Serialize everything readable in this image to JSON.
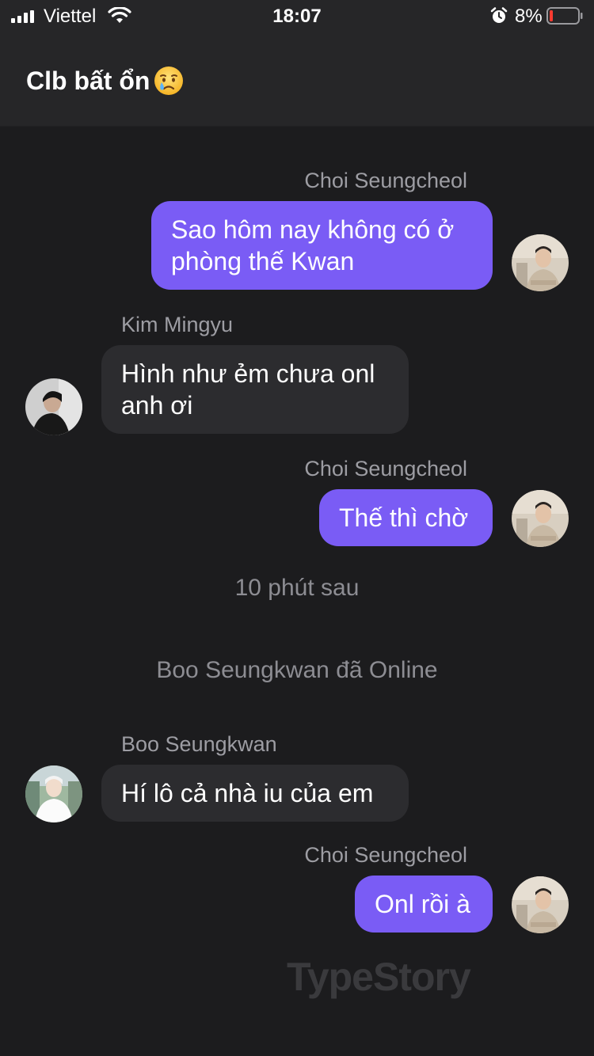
{
  "status_bar": {
    "carrier": "Viettel",
    "time": "18:07",
    "battery": "8%",
    "icons": [
      "signal-icon",
      "wifi-icon",
      "alarm-icon",
      "battery-icon"
    ]
  },
  "header": {
    "title": "Clb bất ổn",
    "emoji": "crying-face"
  },
  "messages": [
    {
      "sender": "Choi Seungcheol",
      "lines": [
        "Sao hôm nay không có ở",
        "phòng thế Kwan"
      ],
      "side": "right"
    },
    {
      "sender": "Kim Mingyu",
      "lines": [
        "Hình như ẻm chưa onl",
        "anh ơi"
      ],
      "side": "left"
    },
    {
      "sender": "Choi Seungcheol",
      "lines": [
        "Thế thì chờ"
      ],
      "side": "right"
    },
    {
      "sender": "Boo Seungkwan",
      "lines": [
        "Hí lô cả nhà iu của em"
      ],
      "side": "left"
    },
    {
      "sender": "Choi Seungcheol",
      "lines": [
        "Onl rồi à"
      ],
      "side": "right"
    }
  ],
  "system": {
    "time_gap": "10 phút sau",
    "online_notice": "Boo Seungkwan đã Online"
  },
  "watermark": "TypeStory",
  "colors": {
    "background": "#1c1c1e",
    "header": "#262628",
    "outgoing_bubble": "#7a5cf5",
    "incoming_bubble": "#2c2c2f",
    "muted_text": "#9d9da3",
    "battery_low": "#ff3b30"
  }
}
